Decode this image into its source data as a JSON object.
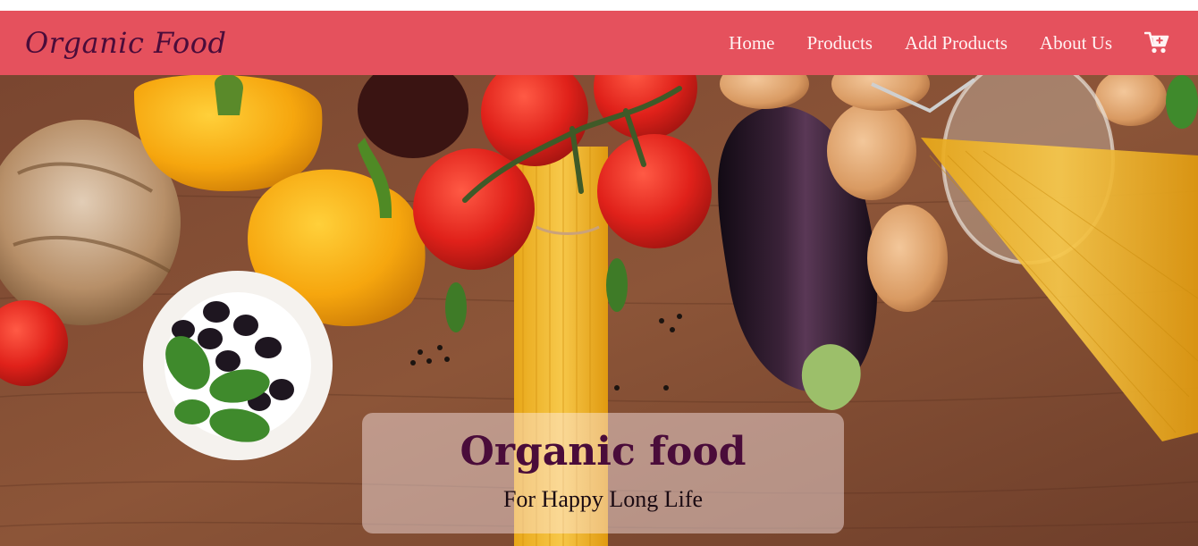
{
  "brand": {
    "name": "Organic Food"
  },
  "nav": {
    "items": [
      {
        "label": "Home"
      },
      {
        "label": "Products"
      },
      {
        "label": "Add Products"
      },
      {
        "label": "About Us"
      }
    ],
    "cart_icon": "shopping-cart-icon"
  },
  "hero": {
    "title": "Organic food",
    "subtitle": "For Happy Long Life",
    "image_subject": "vegetables-on-wooden-table"
  },
  "colors": {
    "navbar": "#e5515d",
    "brand_text": "#4a0c3a",
    "nav_text": "#fff3f3",
    "hero_title": "#4a0c3a"
  }
}
